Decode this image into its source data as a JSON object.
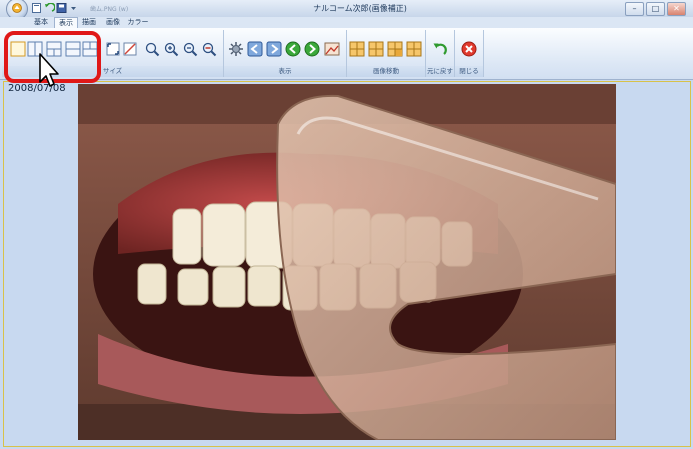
{
  "window": {
    "title": "ナルコーム次郎(画像補正)",
    "qat_filename": "歯ム.PNG (w)",
    "controls": {
      "minimize": "–",
      "maximize": "□",
      "close": "✕"
    }
  },
  "tabs": [
    {
      "label": "基本",
      "active": false
    },
    {
      "label": "表示",
      "active": true
    },
    {
      "label": "描画",
      "active": false
    },
    {
      "label": "画像",
      "active": false
    },
    {
      "label": "カラー",
      "active": false
    }
  ],
  "ribbon": {
    "groups": [
      {
        "label": "サイズ"
      },
      {
        "label": "表示"
      },
      {
        "label": "画像移動"
      },
      {
        "label": "元に戻す"
      },
      {
        "label": "閉じる"
      }
    ]
  },
  "content": {
    "date": "2008/07/08"
  },
  "colors": {
    "highlight": "#e01818",
    "ribbon_bg": "#dce7f5",
    "content_bg": "#c8d9f0",
    "photo_frame": "#d8c24a"
  }
}
